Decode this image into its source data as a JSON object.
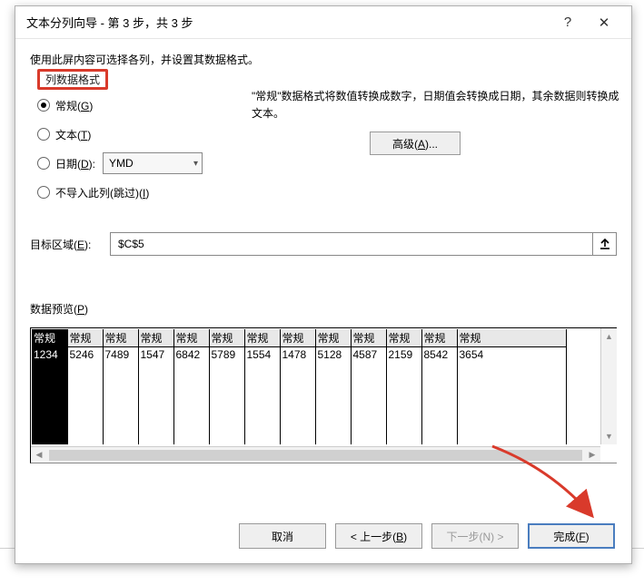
{
  "titlebar": {
    "title": "文本分列向导 - 第 3 步，共 3 步",
    "help": "?",
    "close": "✕"
  },
  "instruction": "使用此屏内容可选择各列，并设置其数据格式。",
  "format_group": {
    "legend": "列数据格式",
    "general": "常规(G)",
    "text": "文本(T)",
    "date": "日期(D):",
    "date_value": "YMD",
    "skip": "不导入此列(跳过)(I)"
  },
  "description": "\"常规\"数据格式将数值转换成数字，日期值会转换成日期，其余数据则转换成文本。",
  "advanced_label": "高级(A)...",
  "destination": {
    "label": "目标区域(E):",
    "value": "$C$5"
  },
  "preview": {
    "label": "数据预览(P)",
    "headers": [
      "常规",
      "常规",
      "常规",
      "常规",
      "常规",
      "常规",
      "常规",
      "常规",
      "常规",
      "常规",
      "常规",
      "常规",
      "常规"
    ],
    "row": [
      "1234",
      "5246",
      "7489",
      "1547",
      "6842",
      "5789",
      "1554",
      "1478",
      "5128",
      "4587",
      "2159",
      "8542",
      "3654"
    ]
  },
  "buttons": {
    "cancel": "取消",
    "back": "< 上一步(B)",
    "next": "下一步(N) >",
    "finish": "完成(F)"
  }
}
